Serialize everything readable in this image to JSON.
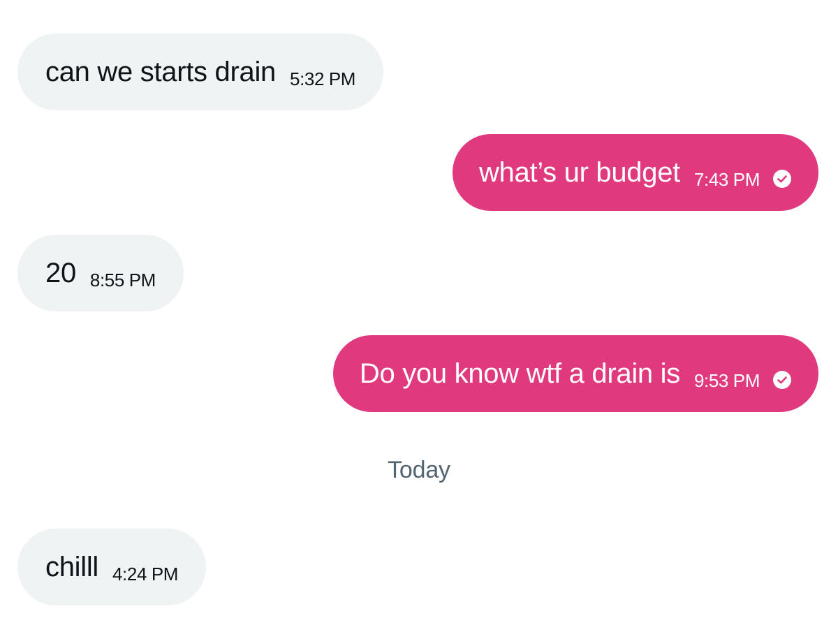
{
  "messages": [
    {
      "direction": "received",
      "text": "can we starts drain",
      "time": "5:32 PM"
    },
    {
      "direction": "sent",
      "text": "what’s ur budget",
      "time": "7:43 PM",
      "status_icon": "check-circle-icon"
    },
    {
      "direction": "received",
      "text": "20",
      "time": "8:55 PM"
    },
    {
      "direction": "sent",
      "text": "Do you know wtf a drain is",
      "time": "9:53 PM",
      "status_icon": "check-circle-icon"
    }
  ],
  "day_divider": "Today",
  "today_messages": [
    {
      "direction": "received",
      "text": "chilll",
      "time": "4:24 PM"
    }
  ],
  "colors": {
    "sent_bubble": "#e1397e",
    "received_bubble": "#eff3f4",
    "received_text": "#0f1419",
    "divider_text": "#536471"
  }
}
